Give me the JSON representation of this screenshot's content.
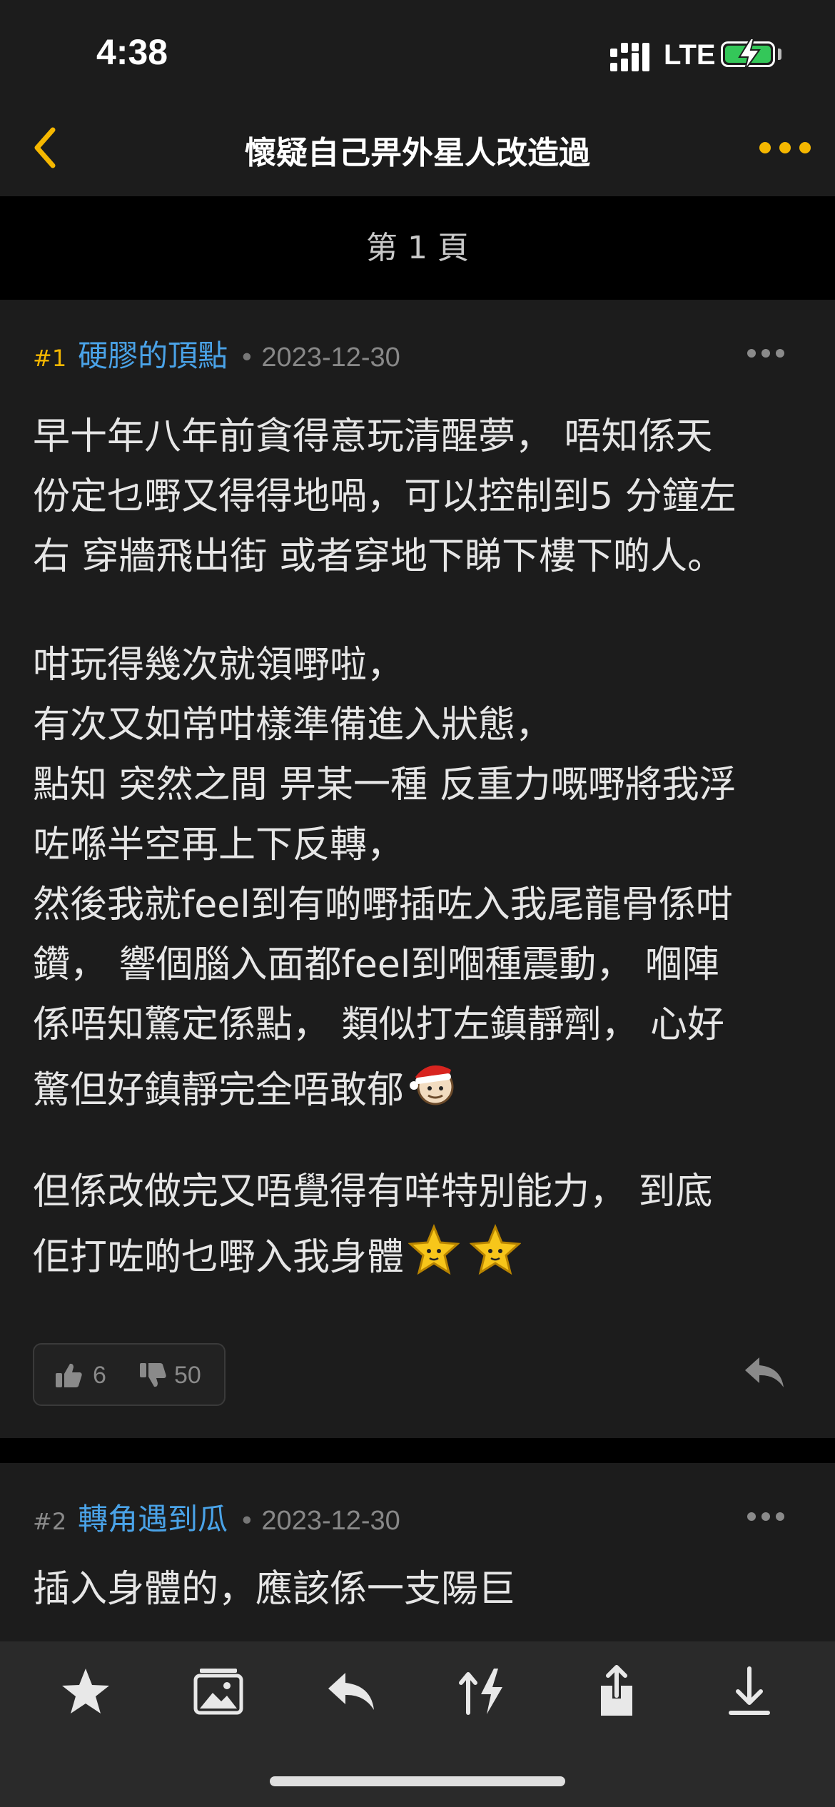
{
  "status_bar": {
    "time": "4:38",
    "network": "LTE"
  },
  "nav": {
    "title": "懷疑自己畀外星人改造過"
  },
  "page_indicator": "第 1 頁",
  "posts": [
    {
      "number": "#1",
      "user": "硬膠的頂點",
      "date": "2023-12-30",
      "body": [
        "早十年八年前貪得意玩清醒夢， 唔知係天",
        "份定乜嘢又得得地喎，可以控制到5 分鐘左",
        "右 穿牆飛出街 或者穿地下睇下樓下啲人。",
        "",
        "咁玩得幾次就領嘢啦，",
        "有次又如常咁樣準備進入狀態，",
        "點知 突然之間 畀某一種 反重力嘅嘢將我浮",
        "咗喺半空再上下反轉，",
        "然後我就feel到有啲嘢插咗入我尾龍骨係咁",
        "鑽， 響個腦入面都feel到嗰種震動， 嗰陣",
        "係唔知驚定係點， 類似打左鎮靜劑， 心好",
        "驚但好鎮靜完全唔敢郁",
        "",
        "但係改做完又唔覺得有咩特別能力， 到底",
        "佢打咗啲乜嘢入我身體"
      ],
      "upvotes": "6",
      "downvotes": "50"
    },
    {
      "number": "#2",
      "user": "轉角遇到瓜",
      "date": "2023-12-30",
      "body": [
        "插入身體的，應該係一支陽巨"
      ]
    }
  ],
  "colors": {
    "accent": "#f5b700",
    "username": "#4aa3e8",
    "battery": "#34c759"
  },
  "toolbar_icons": [
    "star-icon",
    "image-gallery-icon",
    "reply-icon",
    "sort-icon",
    "share-icon",
    "download-icon"
  ]
}
